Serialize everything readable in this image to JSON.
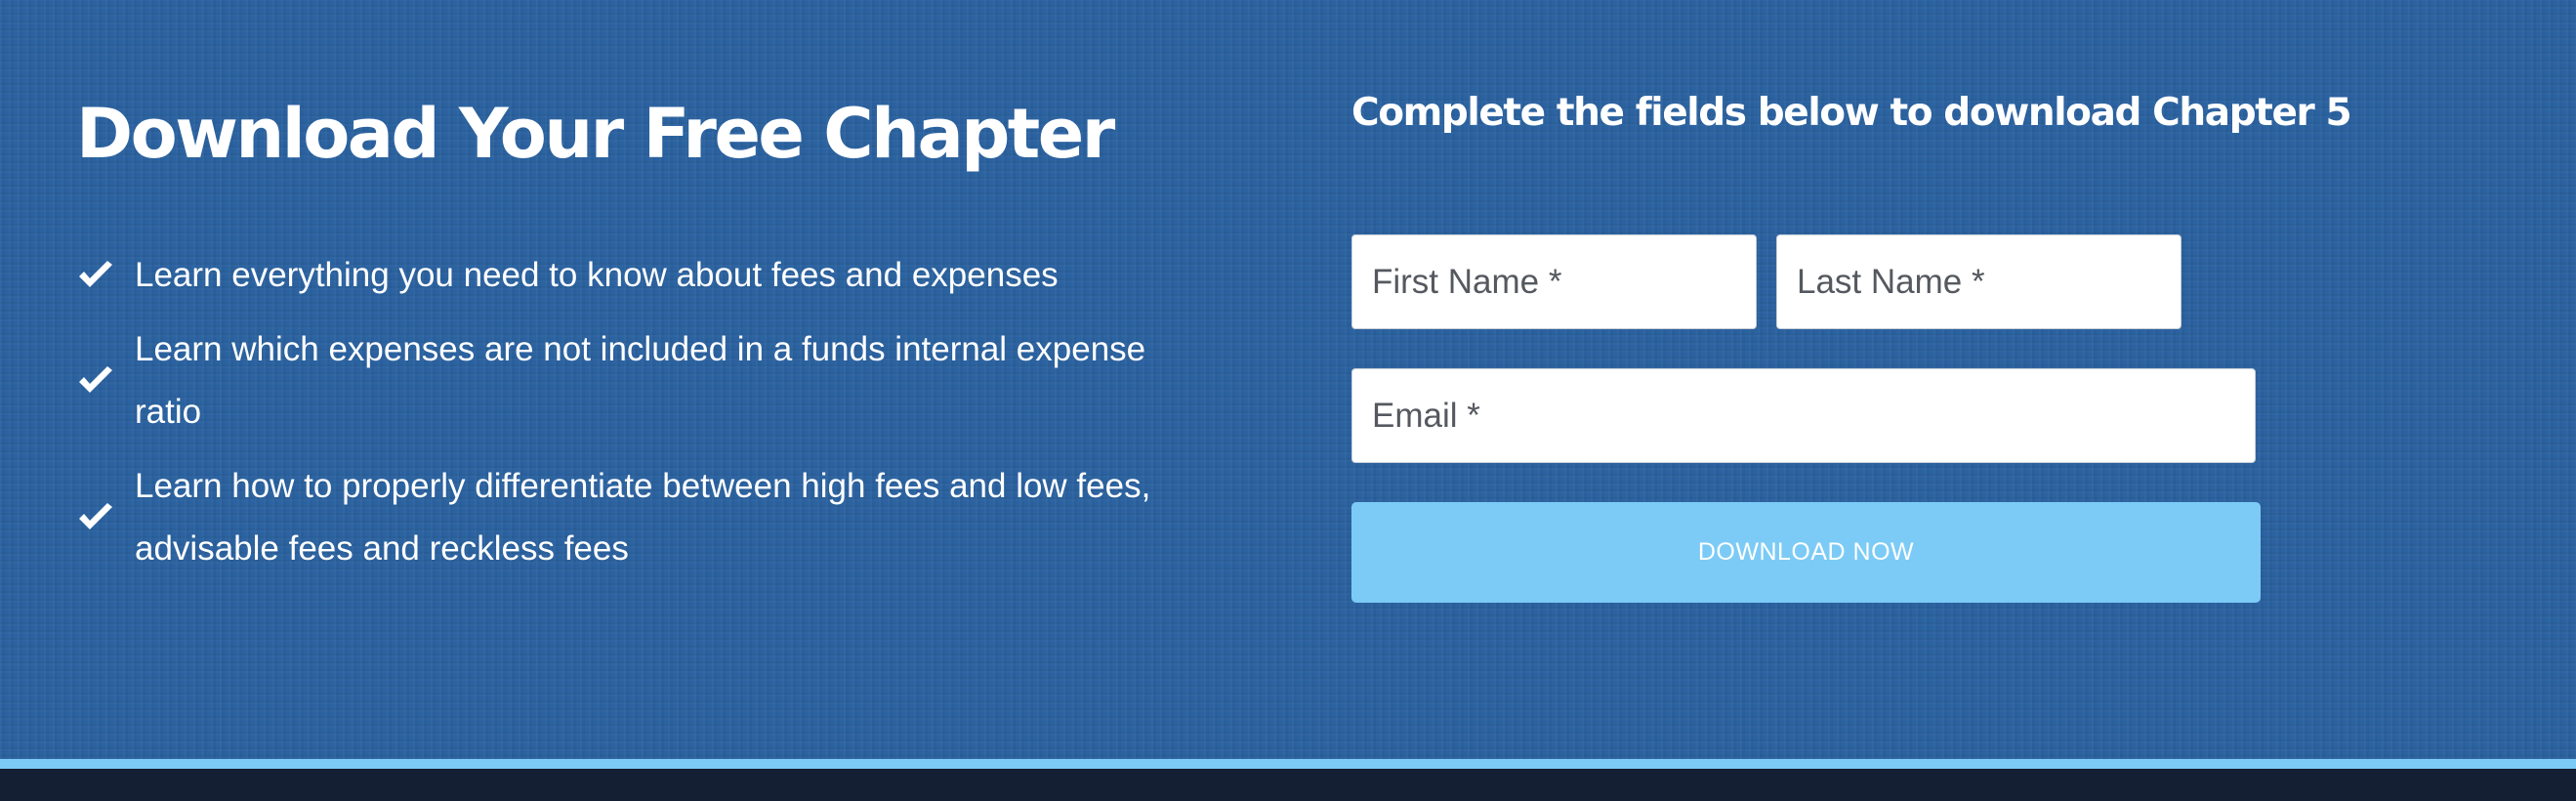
{
  "hero": {
    "heading": "Download Your Free Chapter",
    "benefits": [
      {
        "icon": "check-icon",
        "text": "Learn everything you need to know about fees and expenses"
      },
      {
        "icon": "check-icon",
        "text": "Learn which expenses are not included in a funds internal expense ratio"
      },
      {
        "icon": "check-icon",
        "text": "Learn how to properly differentiate between high fees and low fees, advisable fees and reckless fees"
      }
    ]
  },
  "form": {
    "title": "Complete the fields below to download Chapter 5",
    "first_name_placeholder": "First Name *",
    "last_name_placeholder": "Last Name *",
    "email_placeholder": "Email *",
    "submit_label": "DOWNLOAD NOW"
  },
  "colors": {
    "background": "#2b62a0",
    "accent": "#7ccbf6",
    "footer": "#141f33",
    "text": "#ffffff"
  }
}
